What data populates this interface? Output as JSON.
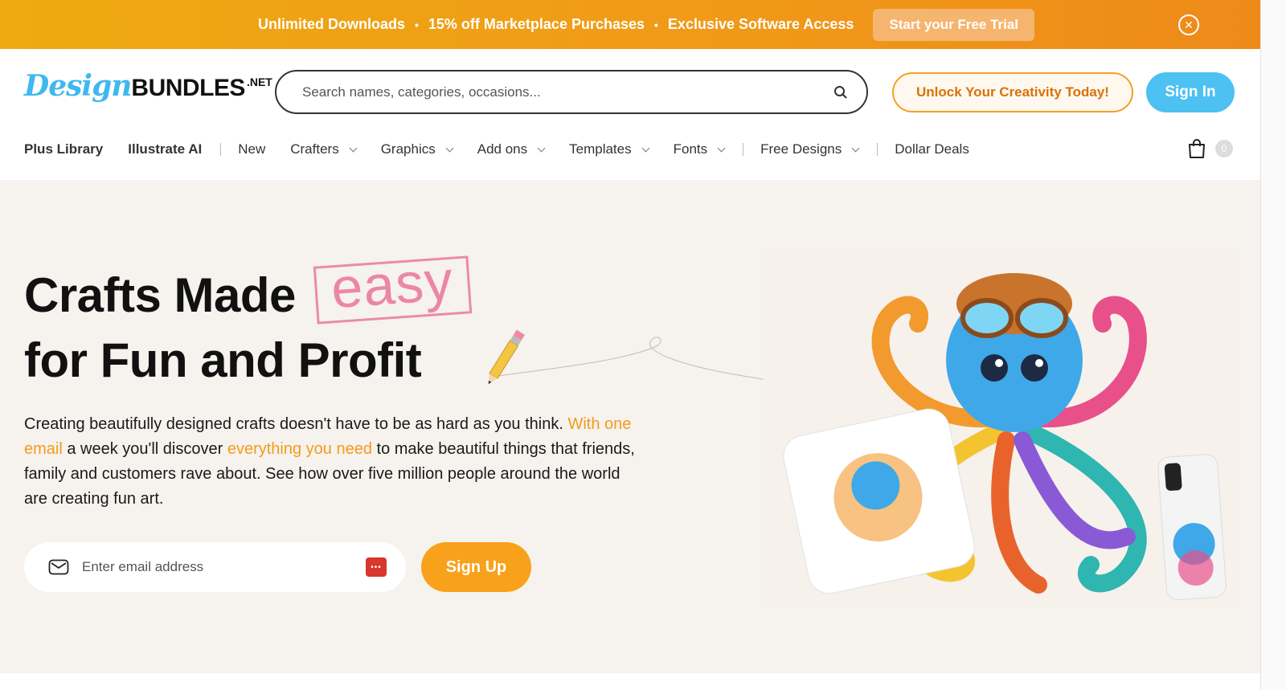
{
  "promo": {
    "items": [
      "Unlimited Downloads",
      "15% off Marketplace Purchases",
      "Exclusive Software Access"
    ],
    "separator": "•",
    "cta_label": "Start your Free Trial",
    "close_icon": "close-circle-icon"
  },
  "header": {
    "logo_script": "Design",
    "logo_bold": "BUNDLES",
    "logo_suffix": ".NET",
    "search_placeholder": "Search names, categories, occasions...",
    "unlock_label": "Unlock Your Creativity Today!",
    "signin_label": "Sign In",
    "cart_count": "0"
  },
  "nav": {
    "plus_library": "Plus Library",
    "illustrate_ai": "Illustrate AI",
    "new": "New",
    "crafters": "Crafters",
    "graphics": "Graphics",
    "add_ons": "Add ons",
    "templates": "Templates",
    "fonts": "Fonts",
    "free_designs": "Free Designs",
    "dollar_deals": "Dollar Deals"
  },
  "hero": {
    "headline_part1": "Crafts Made",
    "headline_highlight": "easy",
    "headline_part2": "for Fun and Profit",
    "lead_1": "Creating beautifully designed crafts doesn't have to be as hard as you think. ",
    "lead_hl1": "With one email",
    "lead_2": " a week you'll discover ",
    "lead_hl2": "everything you need",
    "lead_3": " to make beautiful things that friends, family and customers rave about. See how over five million people around the world are creating fun art.",
    "email_placeholder": "Enter email address",
    "signup_label": "Sign Up"
  },
  "colors": {
    "banner_start": "#eeaa10",
    "banner_end": "#ee8a1a",
    "accent_orange": "#f8a11b",
    "brand_blue": "#4cc1f2",
    "easy_pink": "#ec86a7",
    "hero_bg": "#f6f2ee"
  }
}
